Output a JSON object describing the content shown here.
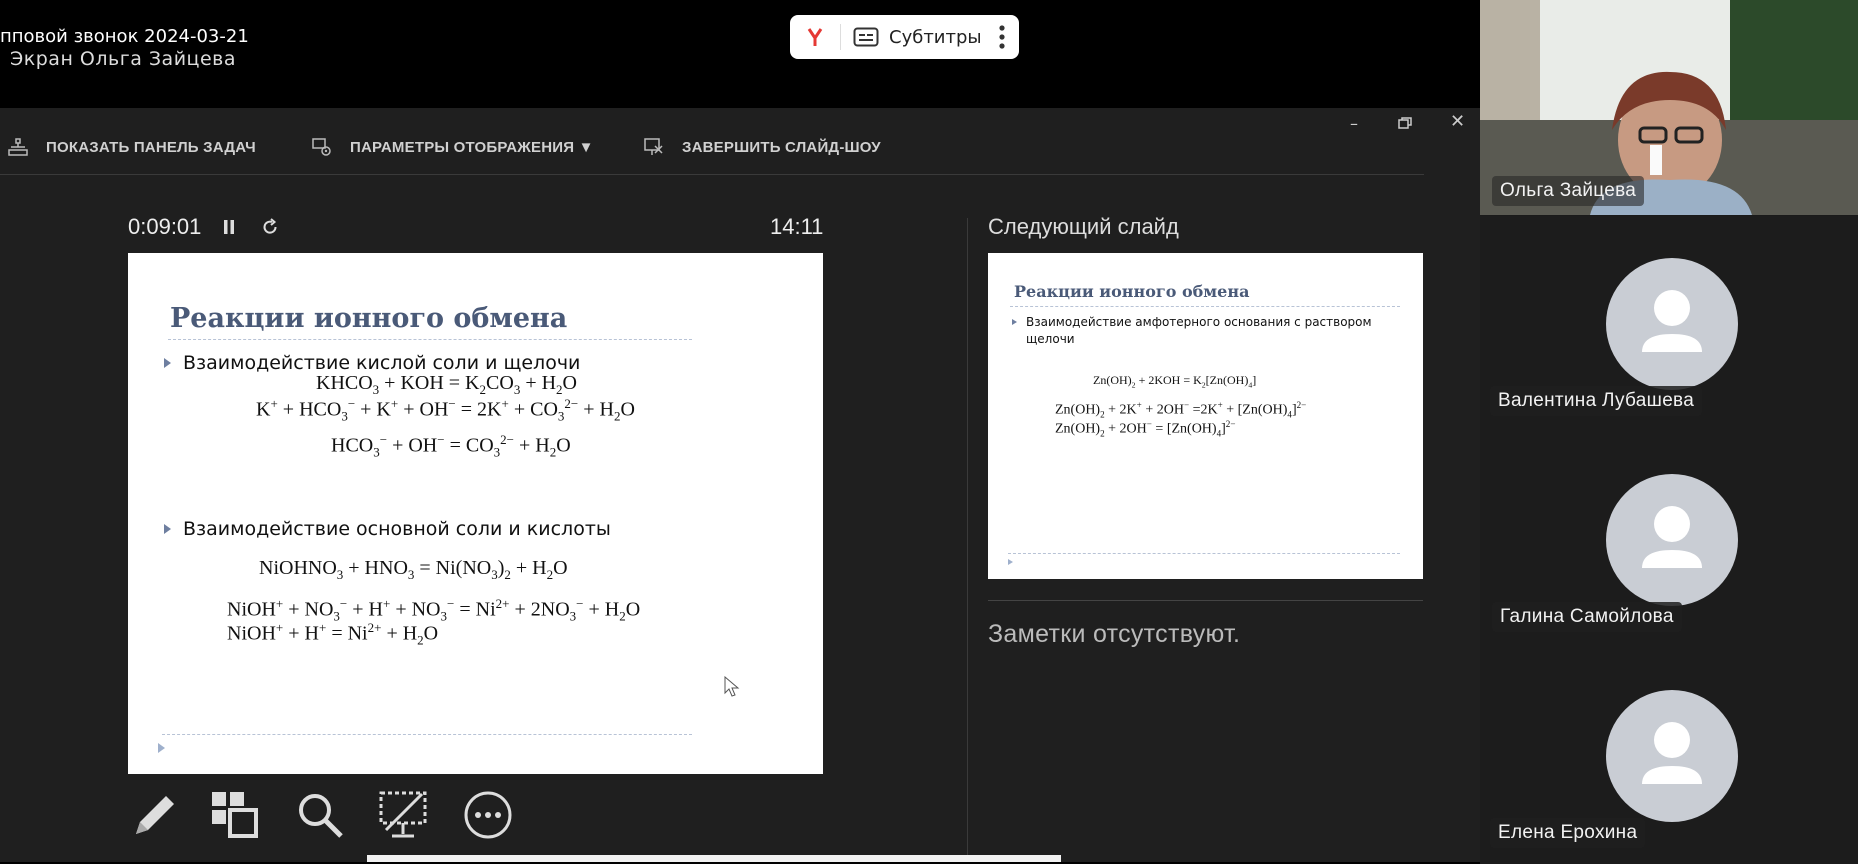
{
  "call": {
    "title": "пповой звонок 2024-03-21",
    "screen_owner": "Экран Ольга Зайцева"
  },
  "captions": {
    "label": "Субтитры",
    "brand_color": "#e53935"
  },
  "toolbar": {
    "show_taskbar": "ПОКАЗАТЬ ПАНЕЛЬ ЗАДАЧ",
    "display_settings": "ПАРАМЕТРЫ ОТОБРАЖЕНИЯ ▼",
    "end_slideshow": "ЗАВЕРШИТЬ СЛАЙД-ШОУ"
  },
  "presenter": {
    "elapsed": "0:09:01",
    "clock": "14:11",
    "next_slide_label": "Следующий слайд",
    "notes": "Заметки отсутствуют."
  },
  "slide": {
    "title": "Реакции ионного обмена",
    "bullet1": "Взаимодействие кислой соли и щелочи",
    "bullet2": "Взаимодействие основной соли и кислоты"
  },
  "next_slide": {
    "title": "Реакции ионного обмена",
    "bullet1_line1": "Взаимодействие амфотерного основания с раствором",
    "bullet1_line2": "щелочи"
  },
  "participants": [
    {
      "name": "Ольга Зайцева",
      "video": true
    },
    {
      "name": "Валентина Лубашева",
      "video": false
    },
    {
      "name": "Галина Самойлова",
      "video": false
    },
    {
      "name": "Елена Ерохина",
      "video": false
    }
  ]
}
